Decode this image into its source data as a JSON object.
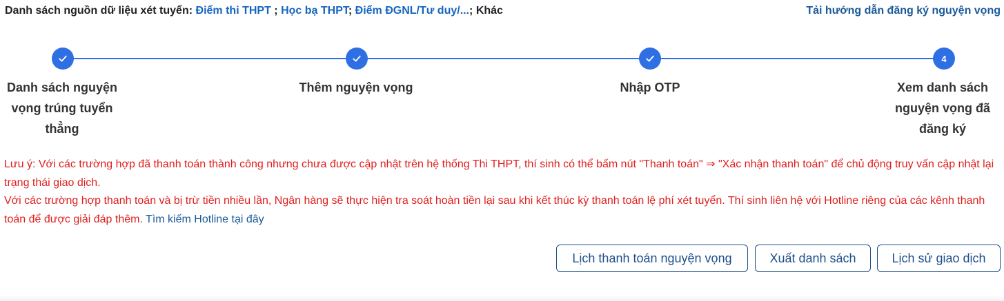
{
  "header": {
    "sources_label": "Danh sách nguồn dữ liệu xét tuyển:",
    "sources": [
      {
        "text": "Điểm thi THPT",
        "after": " ; "
      },
      {
        "text": "Học bạ THPT",
        "after": "; "
      },
      {
        "text": "Điểm ĐGNL/Tư duy/...",
        "after": "; "
      }
    ],
    "sources_other": "Khác",
    "guide_link": "Tải hướng dẫn đăng ký nguyện vọng"
  },
  "stepper": {
    "accent_color": "#2f6fe4",
    "steps": [
      {
        "label": "Danh sách nguyện vọng trúng tuyển thẳng",
        "status": "done",
        "icon": "check-icon",
        "number": ""
      },
      {
        "label": "Thêm nguyện vọng",
        "status": "done",
        "icon": "check-icon",
        "number": ""
      },
      {
        "label": "Nhập OTP",
        "status": "done",
        "icon": "check-icon",
        "number": ""
      },
      {
        "label": "Xem danh sách nguyện vọng đã đăng ký",
        "status": "current",
        "icon": "",
        "number": "4"
      }
    ]
  },
  "notice": {
    "color": "#e11d1d",
    "paragraph1": "Lưu ý: Với các trường hợp đã thanh toán thành công nhưng chưa được cập nhật trên hệ thống Thi THPT, thí sinh có thể bấm nút \"Thanh toán\" ⇒ \"Xác nhận thanh toán\" để chủ động truy vấn cập nhật lại trạng thái giao dịch.",
    "paragraph2": "Với các trường hợp thanh toán và bị trừ tiền nhiều lần, Ngân hàng sẽ thực hiện tra soát hoàn tiền lại sau khi kết thúc kỳ thanh toán lệ phí xét tuyển. Thí sinh liên hệ với Hotline riêng của các kênh thanh toán để được giải đáp thêm.",
    "hotline_link": "Tìm kiếm Hotline tại đây"
  },
  "actions": {
    "payment_schedule": "Lịch thanh toán nguyện vọng",
    "export_list": "Xuất danh sách",
    "transaction_history": "Lịch sử giao dịch"
  }
}
